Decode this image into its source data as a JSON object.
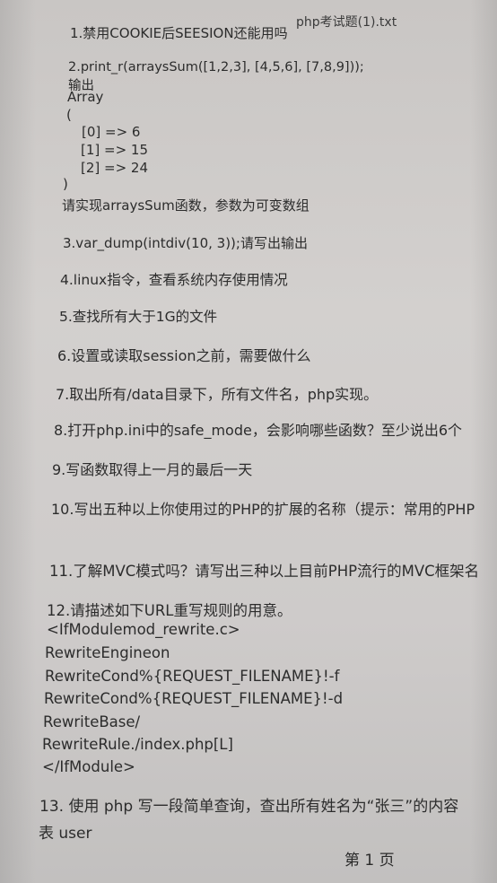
{
  "header_title": "php考试题(1).txt",
  "lines": [
    "1.禁用COOKIE后SEESION还能用吗",
    "2.print_r(arraysSum([1,2,3], [4,5,6], [7,8,9]));",
    "输出",
    "Array",
    "(",
    "[0] => 6",
    "[1] => 15",
    "[2] => 24",
    ")",
    "请实现arraysSum函数，参数为可变数组",
    "3.var_dump(intdiv(10, 3));请写出输出",
    "4.linux指令，查看系统内存使用情况",
    "5.查找所有大于1G的文件",
    "6.设置或读取session之前，需要做什么",
    "7.取出所有/data目录下，所有文件名，php实现。",
    "8.打开php.ini中的safe_mode，会影响哪些函数？至少说出6个",
    "9.写函数取得上一月的最后一天",
    "10.写出五种以上你使用过的PHP的扩展的名称（提示：常用的PHP",
    "11.了解MVC模式吗？请写出三种以上目前PHP流行的MVC框架名",
    "12.请描述如下URL重写规则的用意。",
    "<IfModulemod_rewrite.c>",
    "RewriteEngineon",
    "RewriteCond%{REQUEST_FILENAME}!-f",
    "RewriteCond%{REQUEST_FILENAME}!-d",
    "RewriteBase/",
    "RewriteRule./index.php[L]",
    "</IfModule>",
    "13. 使用 php 写一段简单查询，查出所有姓名为“张三”的内容",
    "表 user"
  ],
  "footer_page": "第 1 页"
}
